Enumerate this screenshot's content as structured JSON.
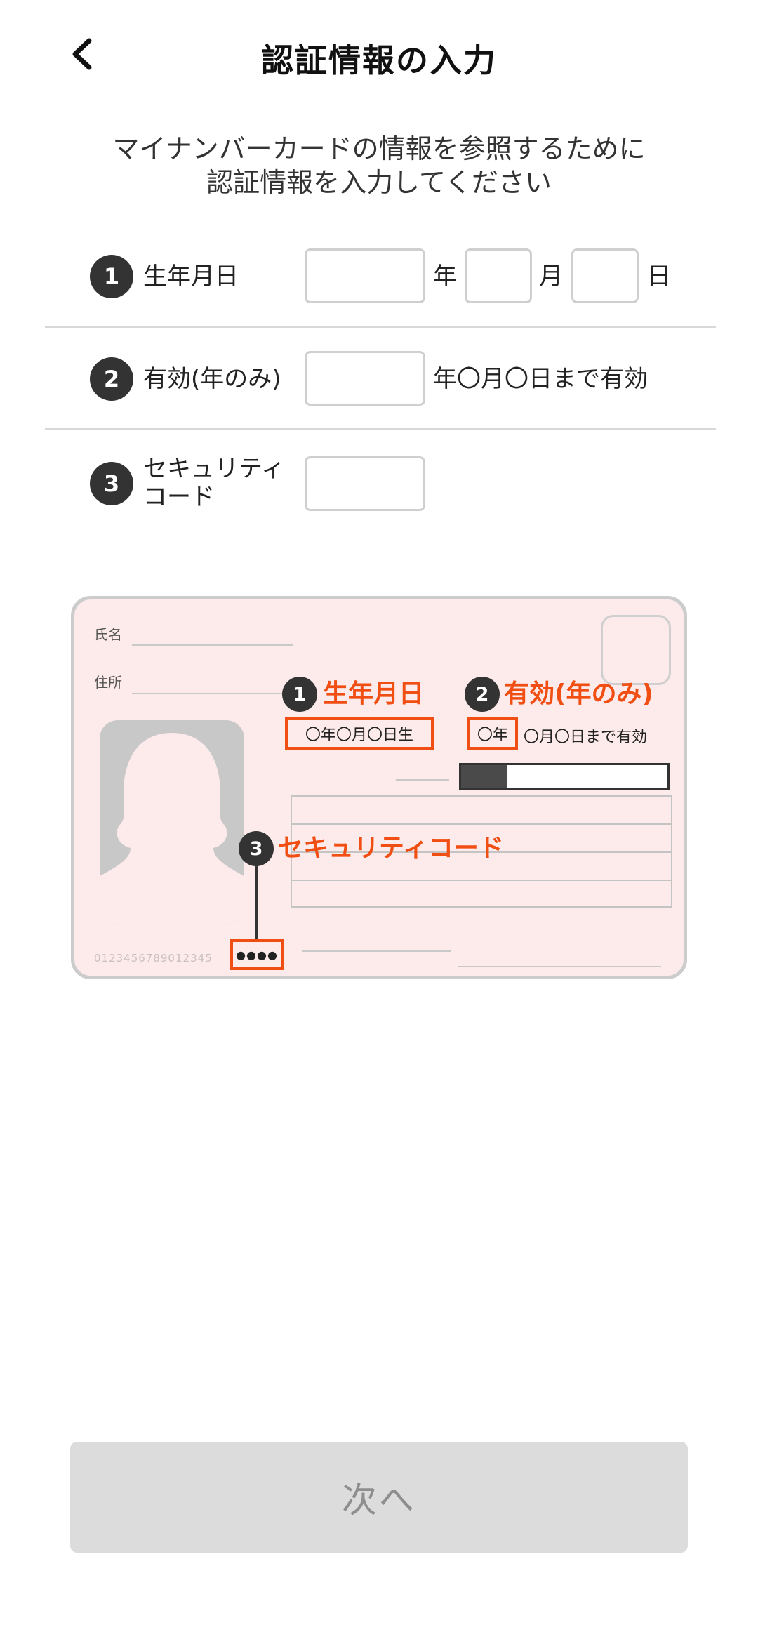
{
  "header": {
    "title": "認証情報の入力",
    "back_icon": "chevron-left-icon"
  },
  "instruction": {
    "line1": "マイナンバーカードの情報を参照するために",
    "line2": "認証情報を入力してください"
  },
  "form": {
    "birthdate": {
      "number": "1",
      "label": "生年月日",
      "year_value": "",
      "month_value": "",
      "day_value": "",
      "year_unit": "年",
      "month_unit": "月",
      "day_unit": "日"
    },
    "expiry": {
      "number": "2",
      "label": "有効(年のみ)",
      "value": "",
      "suffix": "年〇月〇日まで有効"
    },
    "security_code": {
      "number": "3",
      "label_line1": "セキュリティ",
      "label_line2": "コード",
      "value": ""
    }
  },
  "card_illustration": {
    "name_label": "氏名",
    "address_label": "住所",
    "birthdate": {
      "number": "1",
      "label": "生年月日",
      "sample": "〇年〇月〇日生"
    },
    "expiry": {
      "number": "2",
      "label": "有効(年のみ)",
      "sample_year": "〇年",
      "sample_rest": "〇月〇日まで有効"
    },
    "security": {
      "number": "3",
      "label": "セキュリティコード",
      "sample": "●●●●"
    },
    "card_number": "0123456789012345",
    "bar_fill_fraction": 0.22,
    "colors": {
      "card_bg": "#fdeaea",
      "accent": "#f04e12",
      "badge": "#333333"
    }
  },
  "footer": {
    "next_label": "次へ"
  }
}
